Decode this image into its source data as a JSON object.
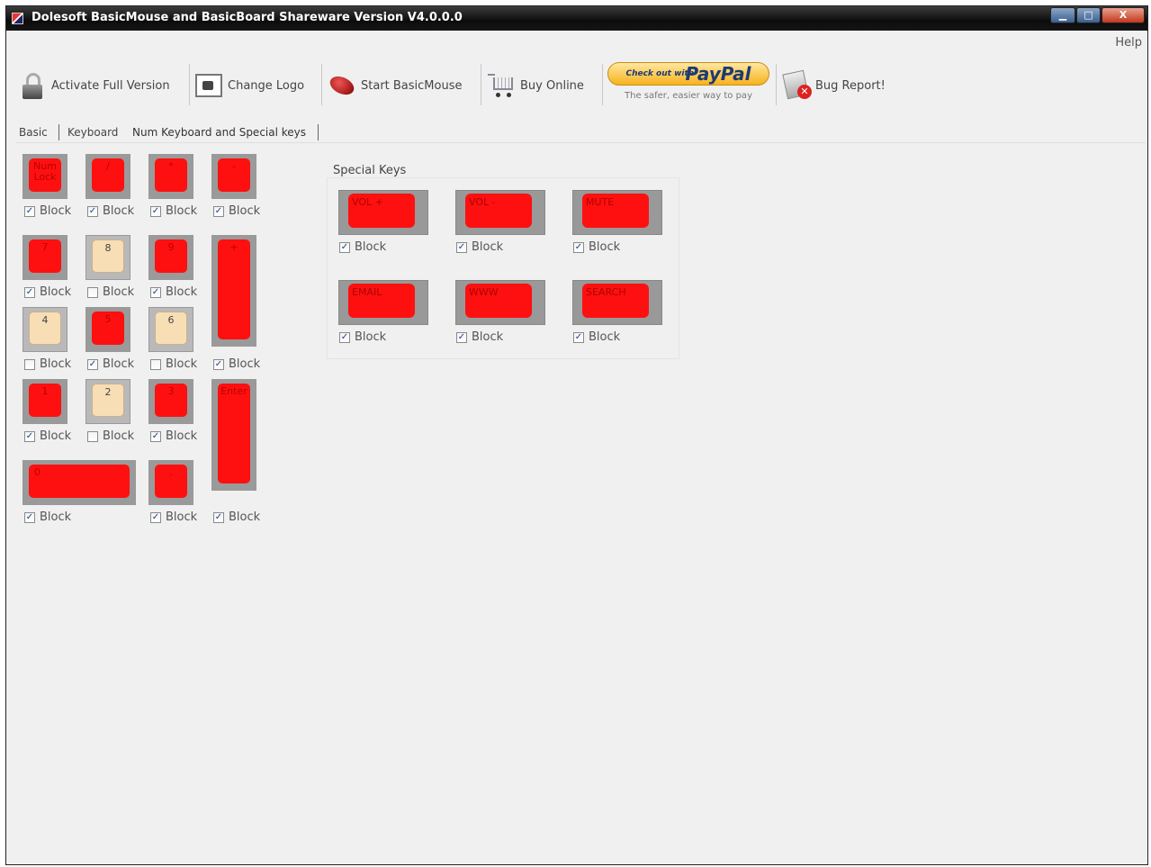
{
  "window": {
    "title": "Dolesoft BasicMouse and BasicBoard Shareware Version V4.0.0.0",
    "min_glyph": "▁",
    "max_glyph": "□",
    "close_glyph": "X"
  },
  "menu": {
    "help": "Help"
  },
  "toolbar": {
    "activate": "Activate Full Version",
    "change_logo": "Change Logo",
    "start_basicmouse": "Start BasicMouse",
    "buy_online": "Buy Online",
    "paypal_small": "Check out with",
    "paypal_logo": "PayPal",
    "paypal_tagline": "The safer, easier way to pay",
    "bug_report": "Bug Report!"
  },
  "tabs": {
    "basic": "Basic",
    "keyboard": "Keyboard",
    "num": "Num Keyboard and Special keys"
  },
  "block_label": "Block",
  "numpad": {
    "numlock": "Num Lock",
    "divide": "/",
    "multiply": "*",
    "minus": "-",
    "k7": "7",
    "k8": "8",
    "k9": "9",
    "plus": "+",
    "k4": "4",
    "k5": "5",
    "k6": "6",
    "k1": "1",
    "k2": "2",
    "k3": "3",
    "enter": "Enter",
    "k0": "0",
    "dot": "."
  },
  "special": {
    "title": "Special Keys",
    "vol_up": "VOL +",
    "vol_down": "VOL -",
    "mute": "MUTE",
    "email": "EMAIL",
    "www": "WWW",
    "search": "SEARCH"
  },
  "checkmark": "✓"
}
